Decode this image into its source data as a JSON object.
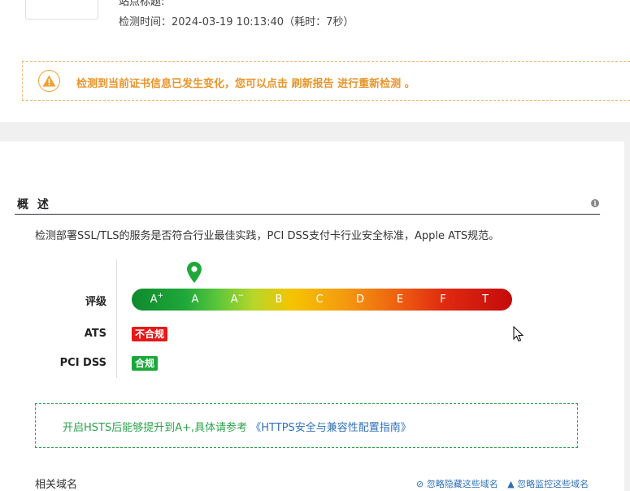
{
  "header": {
    "cut_text": "站点标题:",
    "check_time": "检测时间：2024-03-19 10:13:40（耗时：7秒）"
  },
  "warning": {
    "prefix": "检测到当前证书信息已发生变化，您可以点击 ",
    "link": "刷新报告",
    "suffix": " 进行重新检测 。",
    "icon": "warning-triangle-icon",
    "color": "#e8952a"
  },
  "overview": {
    "title": "概 述",
    "description": "检测部署SSL/TLS的服务是否符合行业最佳实践，PCI DSS支付卡行业安全标准，Apple ATS规范。",
    "rating_label": "评级",
    "grades": [
      {
        "main": "A",
        "sup": "+"
      },
      {
        "main": "A",
        "sup": ""
      },
      {
        "main": "A",
        "sup": "−"
      },
      {
        "main": "B",
        "sup": ""
      },
      {
        "main": "C",
        "sup": ""
      },
      {
        "main": "D",
        "sup": ""
      },
      {
        "main": "E",
        "sup": ""
      },
      {
        "main": "F",
        "sup": ""
      },
      {
        "main": "T",
        "sup": ""
      }
    ],
    "current_grade": "A",
    "ats_label": "ATS",
    "ats_status": "不合规",
    "ats_color": "#e81818",
    "pci_label": "PCI DSS",
    "pci_status": "合规",
    "pci_color": "#1aa83a"
  },
  "tip": {
    "text": "开启HSTS后能够提升到A+,具体请参考 ",
    "link": "《HTTPS安全与兼容性配置指南》"
  },
  "related": {
    "title": "相关域名",
    "links": [
      "⊘ 忽略隐藏这些域名",
      "▲ 忽略监控这些域名"
    ]
  }
}
